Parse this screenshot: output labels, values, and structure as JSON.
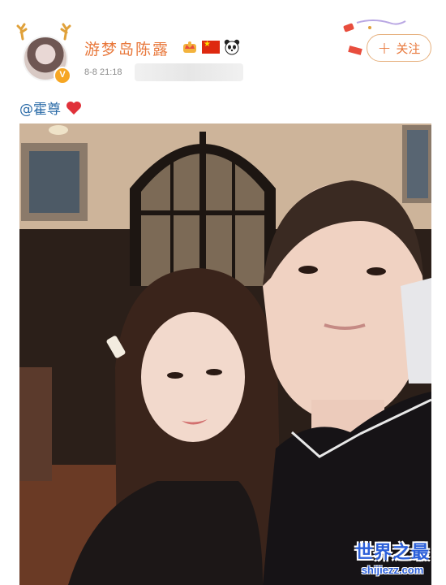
{
  "post": {
    "author": {
      "username": "游梦岛陈露",
      "verified_badge": "V",
      "badges": [
        "crown-icon",
        "china-flag-icon",
        "panda-icon"
      ]
    },
    "timestamp": "8-8 21:18",
    "follow_button": {
      "label": "关注",
      "plus": "+"
    },
    "text": {
      "mention": "@霍尊",
      "emoji": "heart-icon"
    },
    "photo": {
      "description_icon": "selfie-photo"
    }
  },
  "watermark": {
    "title": "世界之最",
    "url": "shijiezz.com"
  },
  "colors": {
    "username": "#e8773a",
    "mention": "#2c6ca8",
    "follow_border": "#e6b07d",
    "watermark": "#2b5fd9",
    "heart": "#e0313a"
  }
}
